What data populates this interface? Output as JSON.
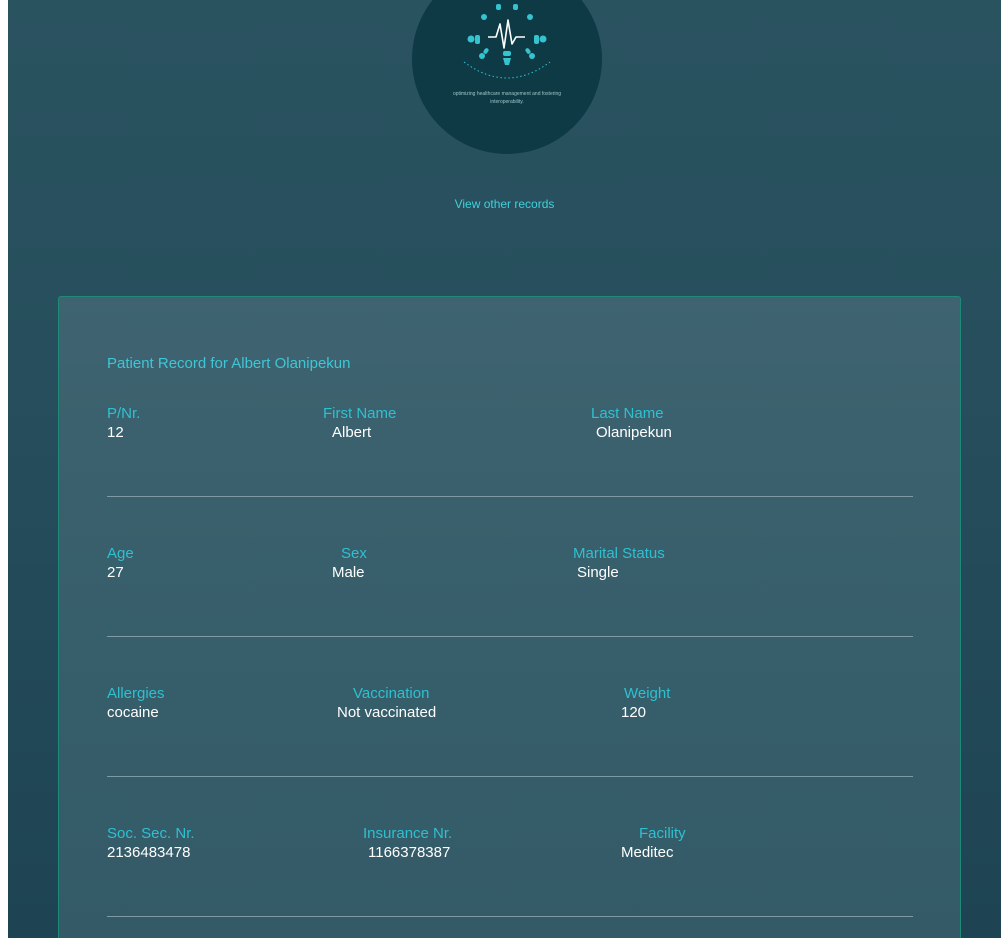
{
  "logo": {
    "tagline": "optimizing healthcare management and fostering interoperability."
  },
  "nav": {
    "view_other_records": "View other records"
  },
  "record": {
    "title": "Patient Record for Albert Olanipekun",
    "rows": [
      [
        {
          "label": "P/Nr.",
          "value": "12"
        },
        {
          "label": "First Name",
          "value": "Albert"
        },
        {
          "label": "Last Name",
          "value": "Olanipekun"
        }
      ],
      [
        {
          "label": "Age",
          "value": "27"
        },
        {
          "label": "Sex",
          "value": "Male"
        },
        {
          "label": "Marital Status",
          "value": "Single"
        }
      ],
      [
        {
          "label": "Allergies",
          "value": "cocaine"
        },
        {
          "label": "Vaccination",
          "value": "Not vaccinated"
        },
        {
          "label": "Weight",
          "value": "120"
        }
      ],
      [
        {
          "label": "Soc. Sec. Nr.",
          "value": "2136483478"
        },
        {
          "label": "Insurance Nr.",
          "value": "1166378387"
        },
        {
          "label": "Facility",
          "value": "Meditec"
        }
      ]
    ]
  },
  "colors": {
    "accent": "#2fc0d0",
    "background": "#264e5c",
    "card": "#3a5f6c",
    "card_border": "#1f8a78"
  }
}
